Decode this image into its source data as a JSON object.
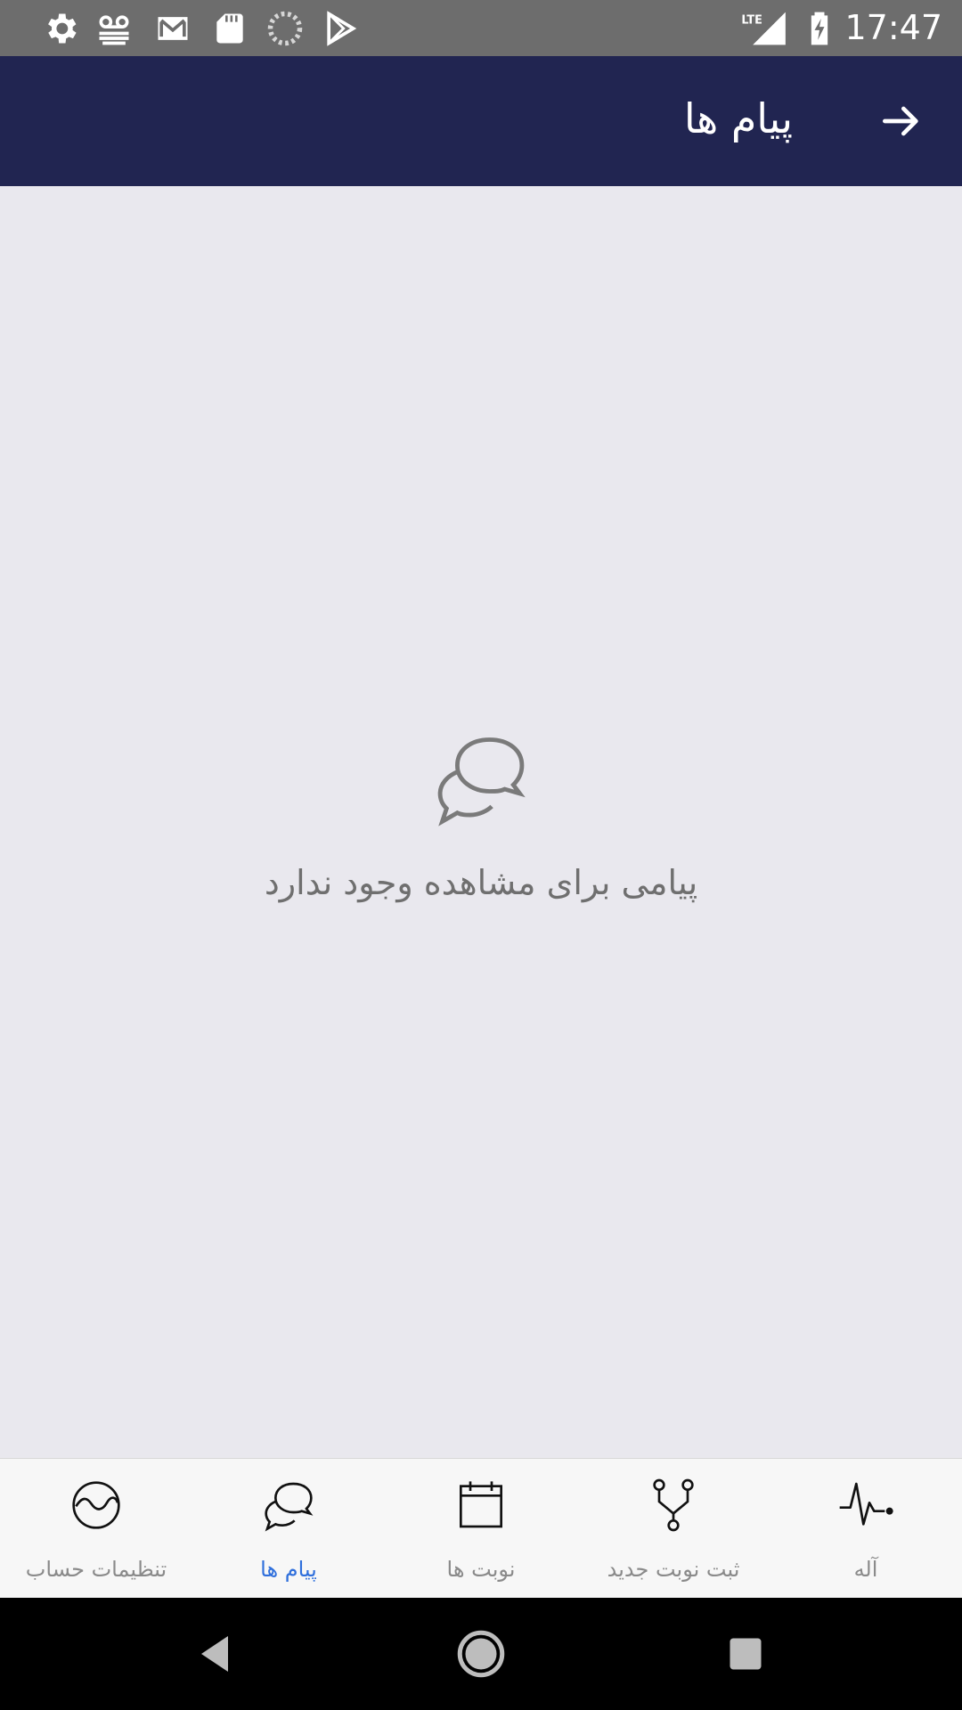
{
  "status_bar": {
    "time": "17:47",
    "network_label": "LTE",
    "left_icons": [
      "settings-icon",
      "voicemail-icon",
      "gmail-icon",
      "sd-card-icon",
      "loading-icon",
      "play-store-icon"
    ],
    "right_icons": [
      "lte-signal-icon",
      "battery-charging-icon"
    ]
  },
  "app_bar": {
    "title": "پیام ها",
    "back_icon": "arrow-right-icon",
    "background": "#212551"
  },
  "empty_state": {
    "icon": "chat-bubbles-icon",
    "message": "پیامی برای مشاهده وجود ندارد"
  },
  "bottom_nav": {
    "items": [
      {
        "label": "تنظیمات حساب",
        "icon": "wave-circle-icon",
        "active": false
      },
      {
        "label": "پیام ها",
        "icon": "chat-bubbles-icon",
        "active": true
      },
      {
        "label": "نوبت ها",
        "icon": "calendar-icon",
        "active": false
      },
      {
        "label": "ثبت نوبت جدید",
        "icon": "branch-icon",
        "active": false
      },
      {
        "label": "آله",
        "icon": "pulse-icon",
        "active": false
      }
    ],
    "active_color": "#2f6fdc",
    "inactive_color": "#8a8a8a"
  },
  "system_nav": {
    "buttons": [
      "back-triangle-icon",
      "home-circle-icon",
      "recents-square-icon"
    ]
  }
}
